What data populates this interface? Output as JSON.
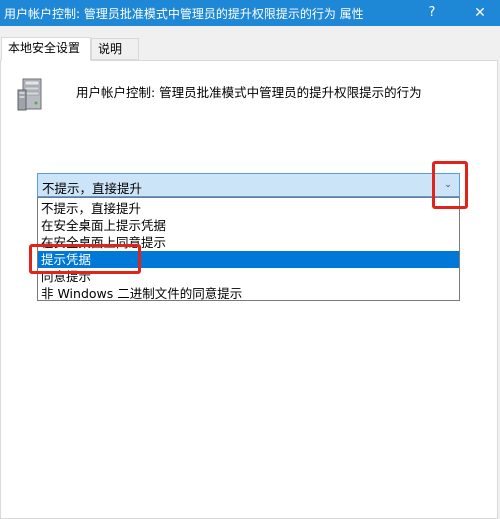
{
  "window": {
    "title": "用户帐户控制: 管理员批准模式中管理员的提升权限提示的行为 属性",
    "help_label": "?",
    "close_label": "✕"
  },
  "tabs": [
    {
      "label": "本地安全设置",
      "active": true
    },
    {
      "label": "说明",
      "active": false
    }
  ],
  "policy": {
    "icon": "server-tower-icon",
    "title": "用户帐户控制: 管理员批准模式中管理员的提升权限提示的行为"
  },
  "combobox": {
    "selected_value": "不提示，直接提升",
    "arrow_icon": "chevron-down-icon"
  },
  "dropdown": {
    "options": [
      {
        "label": "不提示，直接提升",
        "highlighted": false
      },
      {
        "label": "在安全桌面上提示凭据",
        "highlighted": false
      },
      {
        "label": "在安全桌面上同意提示",
        "highlighted": false
      },
      {
        "label": "提示凭据",
        "highlighted": true
      },
      {
        "label": "同意提示",
        "highlighted": false
      },
      {
        "label": "非 Windows 二进制文件的同意提示",
        "highlighted": false
      }
    ]
  },
  "colors": {
    "titlebar": "#1f88d6",
    "selection": "#0078d7",
    "annotation": "#e2231a"
  }
}
